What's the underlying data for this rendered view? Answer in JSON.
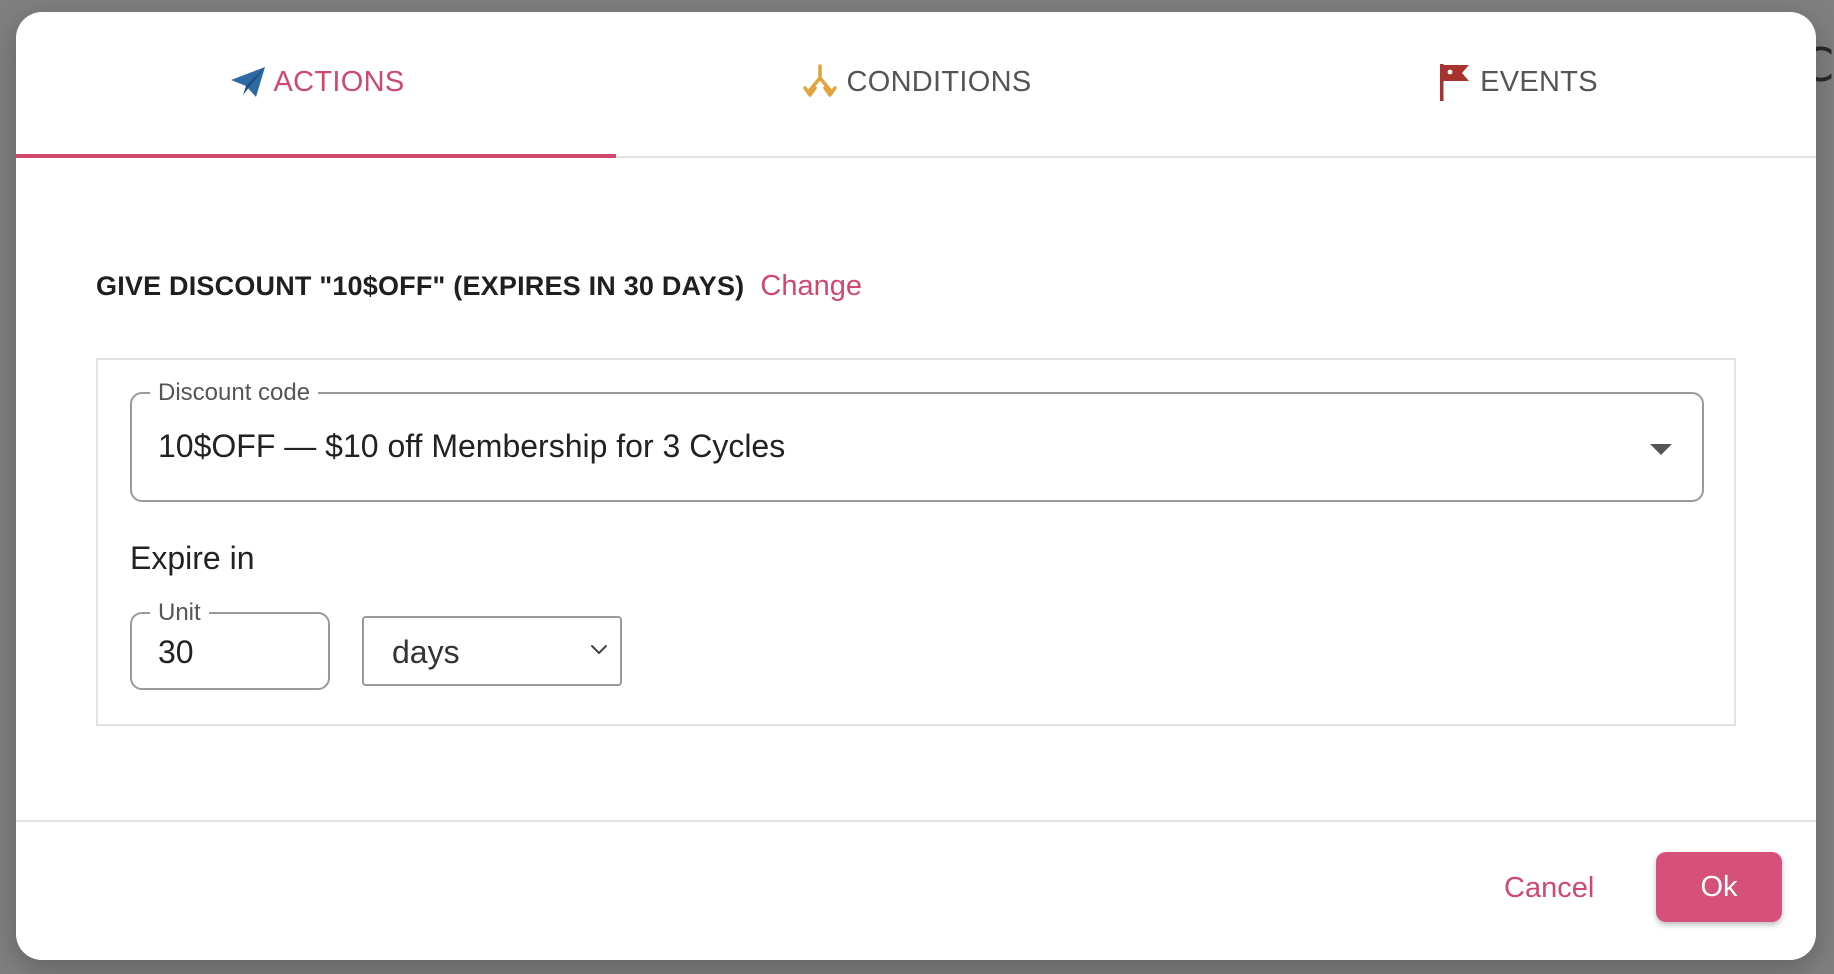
{
  "tabs": [
    {
      "label": "ACTIONS",
      "icon": "paper-plane-icon",
      "active": true
    },
    {
      "label": "CONDITIONS",
      "icon": "branch-split-icon",
      "active": false
    },
    {
      "label": "EVENTS",
      "icon": "flag-icon",
      "active": false
    }
  ],
  "action": {
    "heading": "GIVE DISCOUNT \"10$OFF\" (EXPIRES IN 30 DAYS)",
    "change_label": "Change"
  },
  "discount": {
    "legend": "Discount code",
    "value": "10$OFF — $10 off Membership for 3 Cycles"
  },
  "expire": {
    "label": "Expire in",
    "unit_legend": "Unit",
    "unit_value": "30",
    "period_value": "days"
  },
  "footer": {
    "cancel_label": "Cancel",
    "ok_label": "Ok"
  },
  "colors": {
    "accent": "#d1486f",
    "ok_button": "#d6517a",
    "plane_icon": "#2d6aa3",
    "conditions_icon": "#e2a33b",
    "events_icon": "#a8322d"
  }
}
